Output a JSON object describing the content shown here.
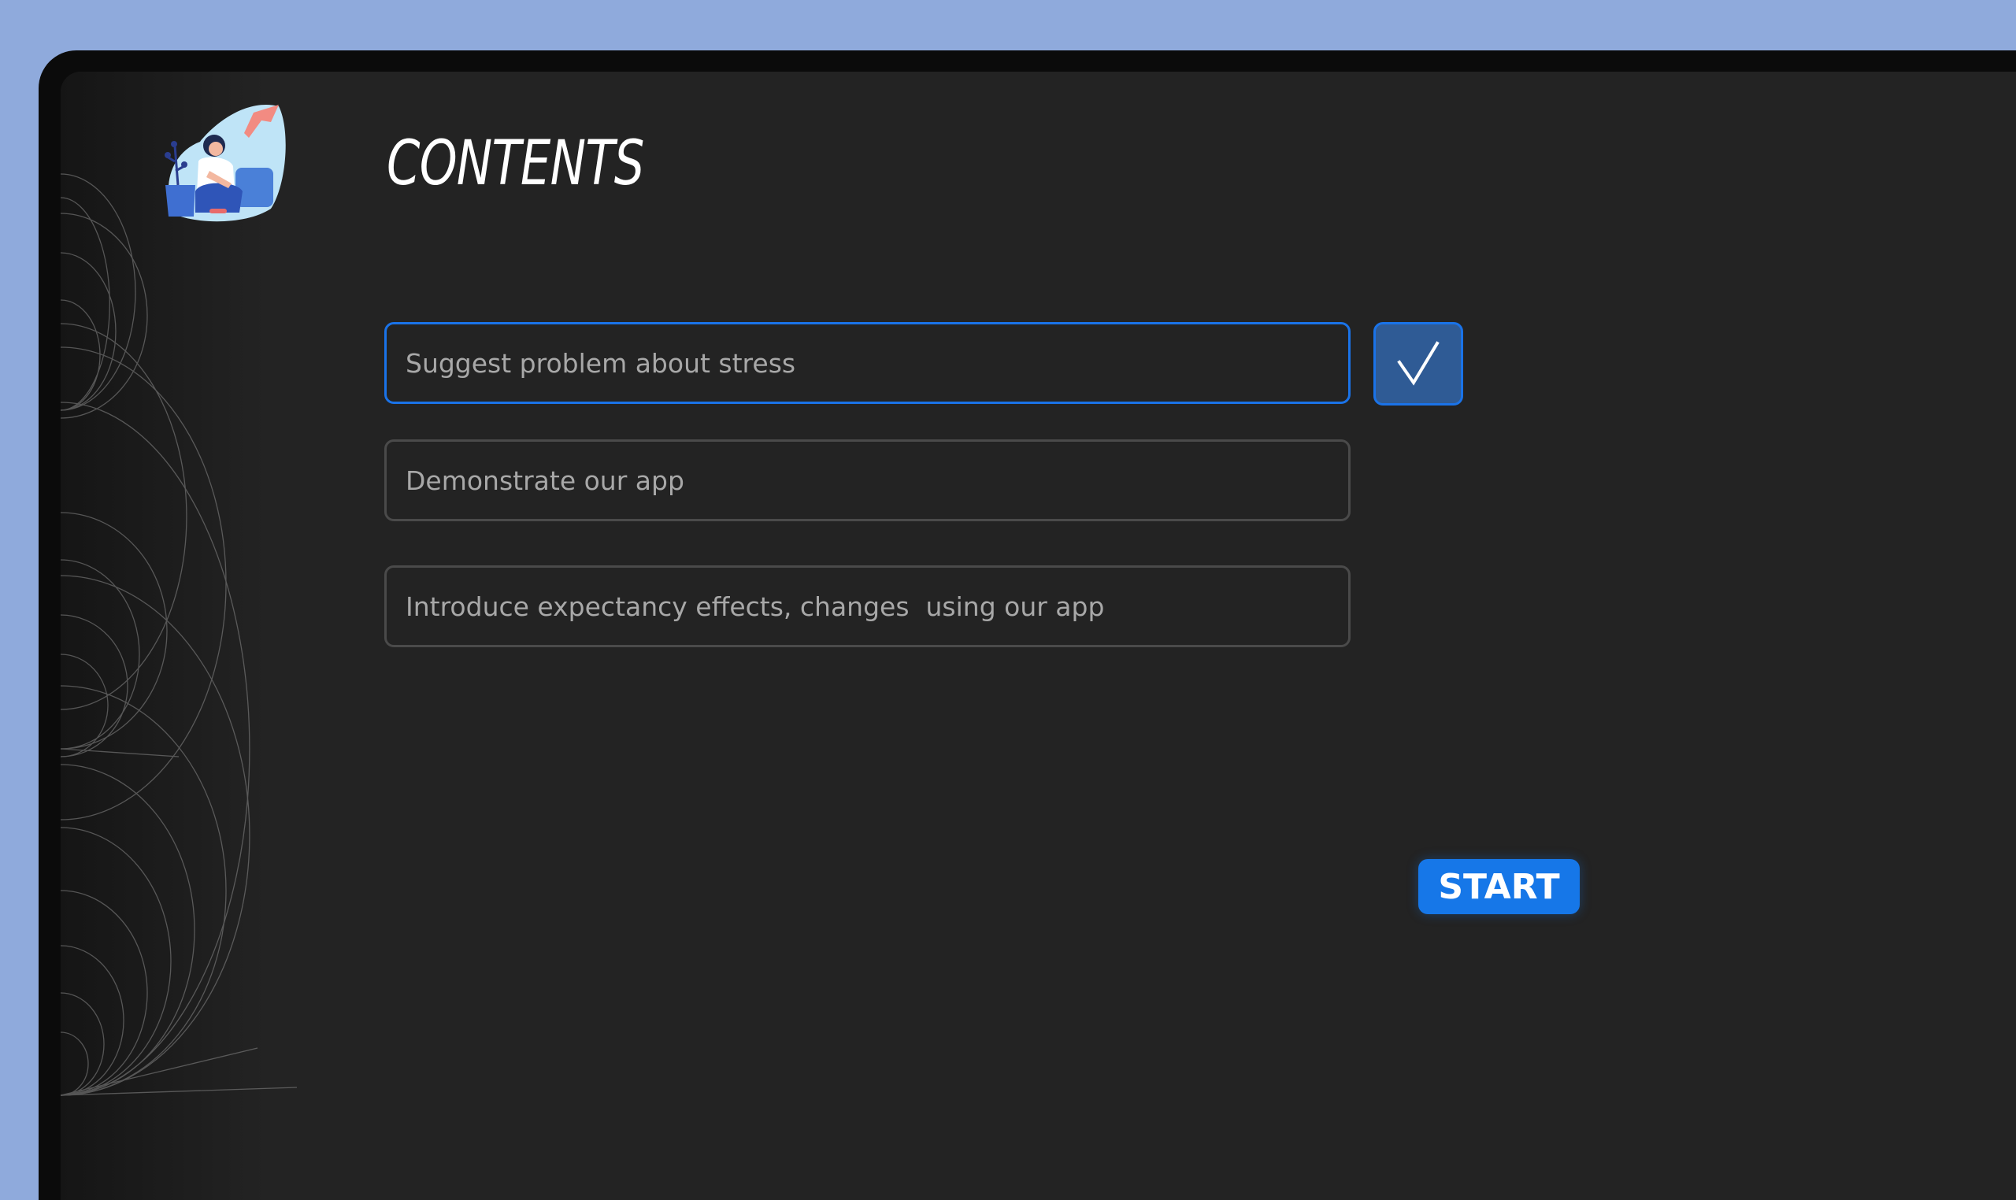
{
  "page": {
    "title": "CONTENTS"
  },
  "items": [
    {
      "label": "Suggest problem about stress",
      "checked": true
    },
    {
      "label": "Demonstrate our app",
      "checked": false
    },
    {
      "label": "Introduce expectancy effects, changes  using our app",
      "checked": false
    }
  ],
  "actions": {
    "start_label": "START"
  },
  "icons": {
    "check": "check-icon",
    "avatar": "illustration-woman-with-dove"
  },
  "colors": {
    "background": "#8faadc",
    "screen": "#232323",
    "accent": "#1677e8",
    "field_border": "#4a4a4a",
    "active_border": "#1a73e8",
    "check_fill": "#2f5b95"
  }
}
